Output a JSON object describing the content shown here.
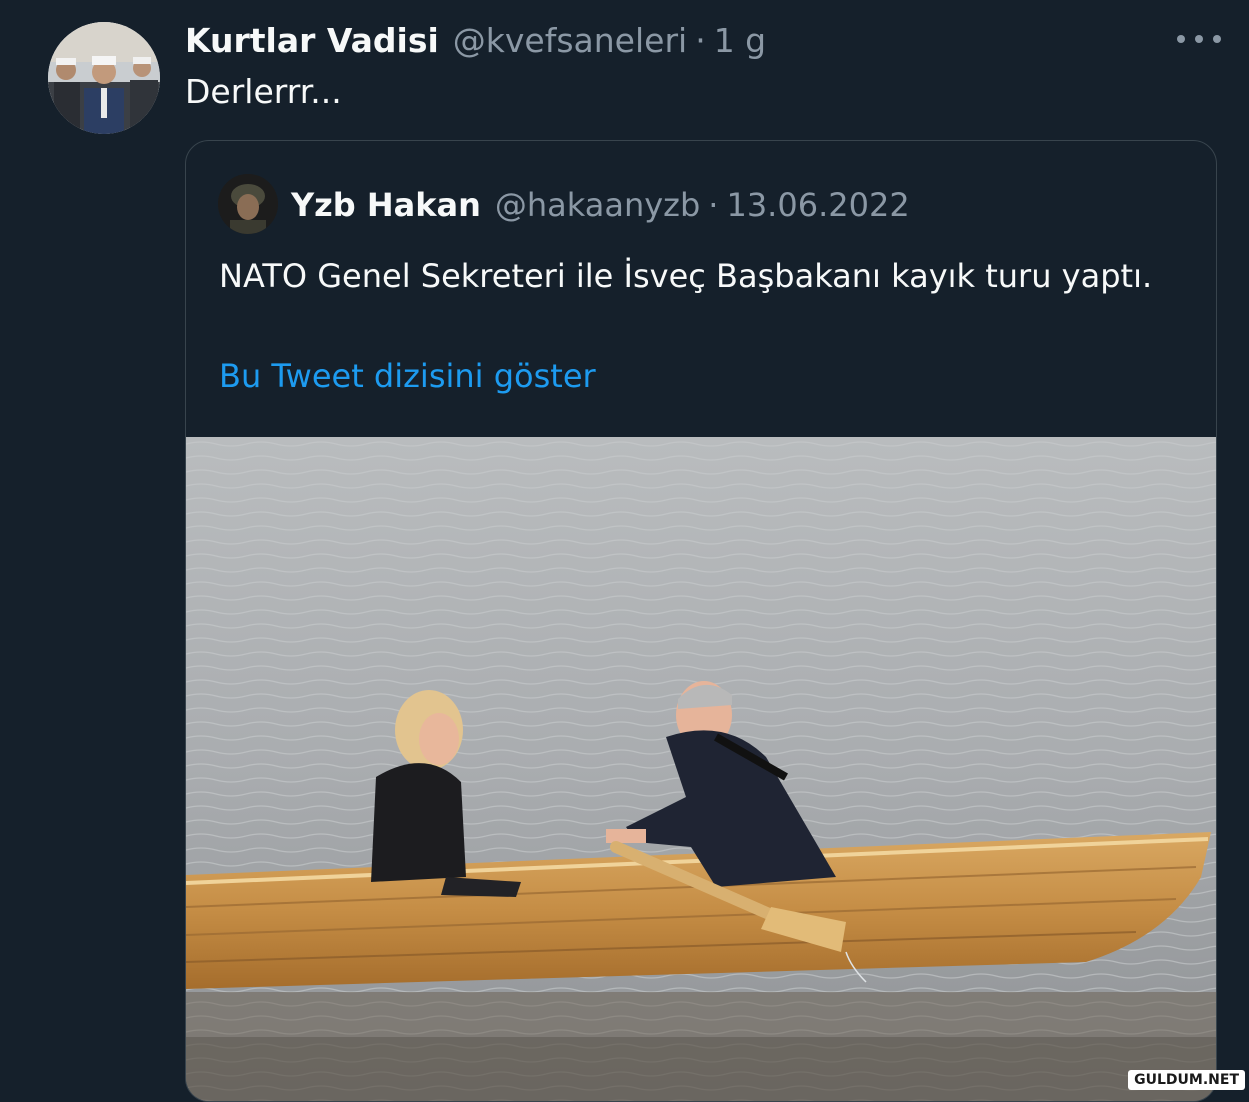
{
  "tweet": {
    "author_name": "Kurtlar Vadisi",
    "author_handle": "@kvefsaneleri",
    "separator": "·",
    "time": "1 g",
    "text": "Derlerrr..."
  },
  "quoted_tweet": {
    "author_name": "Yzb Hakan",
    "author_handle": "@hakaanyzb",
    "separator": "·",
    "date": "13.06.2022",
    "text": "NATO Genel Sekreteri ile İsveç Başbakanı kayık turu yaptı.",
    "show_thread_link": "Bu Tweet dizisini göster"
  },
  "icons": {
    "more": "more-horizontal-icon"
  },
  "watermark": "GULDUM.NET",
  "colors": {
    "background": "#15202b",
    "text": "#f7f9f9",
    "secondary": "#8b98a5",
    "link": "#1d9bf0",
    "border": "#38444d"
  }
}
